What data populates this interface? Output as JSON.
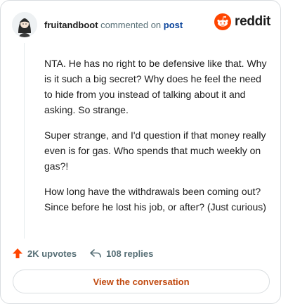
{
  "comment": {
    "username": "fruitandboot",
    "verb": "commented on",
    "post_link": "post",
    "paragraphs": [
      "NTA. He has no right to be defensive like that. Why is it such a big secret? Why does he feel the need to hide from you instead of talking about it and asking. So strange.",
      "Super strange, and I'd question if that money really even is for gas. Who spends that much weekly on gas?!",
      "How long have the withdrawals been coming out? Since before he lost his job, or after? (Just curious)"
    ]
  },
  "brand": {
    "wordmark": "reddit",
    "color": "#ff4500"
  },
  "actions": {
    "upvotes": "2K upvotes",
    "replies": "108 replies",
    "upvote_icon": "upvote-arrow-icon",
    "reply_icon": "reply-arrow-icon",
    "upvote_color": "#ff4500"
  },
  "cta": {
    "label": "View the conversation",
    "color": "#c14a10"
  }
}
